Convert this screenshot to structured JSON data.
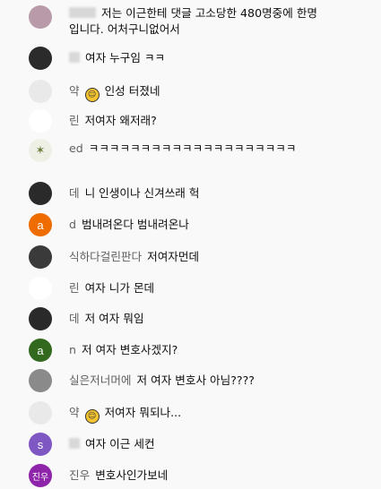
{
  "comments": [
    {
      "author": "",
      "avatar": {
        "kind": "photo",
        "bg": "#b89aa8",
        "fg": "#ffffff",
        "text": ""
      },
      "text": "저는 이근한테 댓글 고소당한 480명중에 한명",
      "text2": "입니다. 어처구니없어서"
    },
    {
      "author": "",
      "avatar": {
        "kind": "photo",
        "bg": "#2b2b2b",
        "fg": "#ffffff",
        "text": ""
      },
      "text": "여자 누구임 ㅋㅋ"
    },
    {
      "author": "약",
      "avatar": {
        "kind": "photo",
        "bg": "#e9e9e9",
        "fg": "#777777",
        "text": ""
      },
      "badge": "face-badge-icon",
      "text": "인성 터졌네"
    },
    {
      "author": "린",
      "avatar": {
        "kind": "blank",
        "bg": "#ffffff",
        "fg": "#ffffff",
        "text": ""
      },
      "text": "저여자 왜저래?"
    },
    {
      "author": "ed",
      "avatar": {
        "kind": "photo",
        "bg": "#eef0e6",
        "fg": "#6a7a3a",
        "text": ""
      },
      "text": "ㅋㅋㅋㅋㅋㅋㅋㅋㅋㅋㅋㅋㅋㅋㅋㅋㅋㅋㅋㅋ"
    },
    {
      "author": "데",
      "avatar": {
        "kind": "photo",
        "bg": "#2a2a2a",
        "fg": "#ffffff",
        "text": ""
      },
      "text": "니 인생이나 신겨쓰래 헉"
    },
    {
      "author": "d",
      "avatar": {
        "kind": "letter",
        "bg": "#ef6c00",
        "fg": "#ffffff",
        "text": "a"
      },
      "text": "범내려온다 범내려온나"
    },
    {
      "author": "식하다걸린판다",
      "avatar": {
        "kind": "photo",
        "bg": "#3a3a3a",
        "fg": "#ffffff",
        "text": ""
      },
      "text": "저여자먼데"
    },
    {
      "author": "린",
      "avatar": {
        "kind": "blank",
        "bg": "#ffffff",
        "fg": "#ffffff",
        "text": ""
      },
      "text": "여자 니가 몬데"
    },
    {
      "author": "데",
      "avatar": {
        "kind": "photo",
        "bg": "#2a2a2a",
        "fg": "#ffffff",
        "text": ""
      },
      "text": "저 여자 뭐임"
    },
    {
      "author": "n",
      "avatar": {
        "kind": "letter",
        "bg": "#33691e",
        "fg": "#ffffff",
        "text": "a"
      },
      "text": "저 여자 변호사겠지?"
    },
    {
      "author": "실은저너머에",
      "avatar": {
        "kind": "photo",
        "bg": "#8a8a8a",
        "fg": "#ffffff",
        "text": ""
      },
      "text": "저 여자 변호사 아님????"
    },
    {
      "author": "약",
      "avatar": {
        "kind": "photo",
        "bg": "#e9e9e9",
        "fg": "#777777",
        "text": ""
      },
      "badge": "face-badge-icon",
      "text": "저여자 뭐되나..."
    },
    {
      "author": "",
      "avatar": {
        "kind": "letter",
        "bg": "#7e57c2",
        "fg": "#ffffff",
        "text": "s"
      },
      "text": "여자 이근 세컨"
    },
    {
      "author": "진우",
      "avatar": {
        "kind": "letter",
        "bg": "#8e24aa",
        "fg": "#ffffff",
        "text": "진우"
      },
      "text": "변호사인가보네"
    }
  ]
}
